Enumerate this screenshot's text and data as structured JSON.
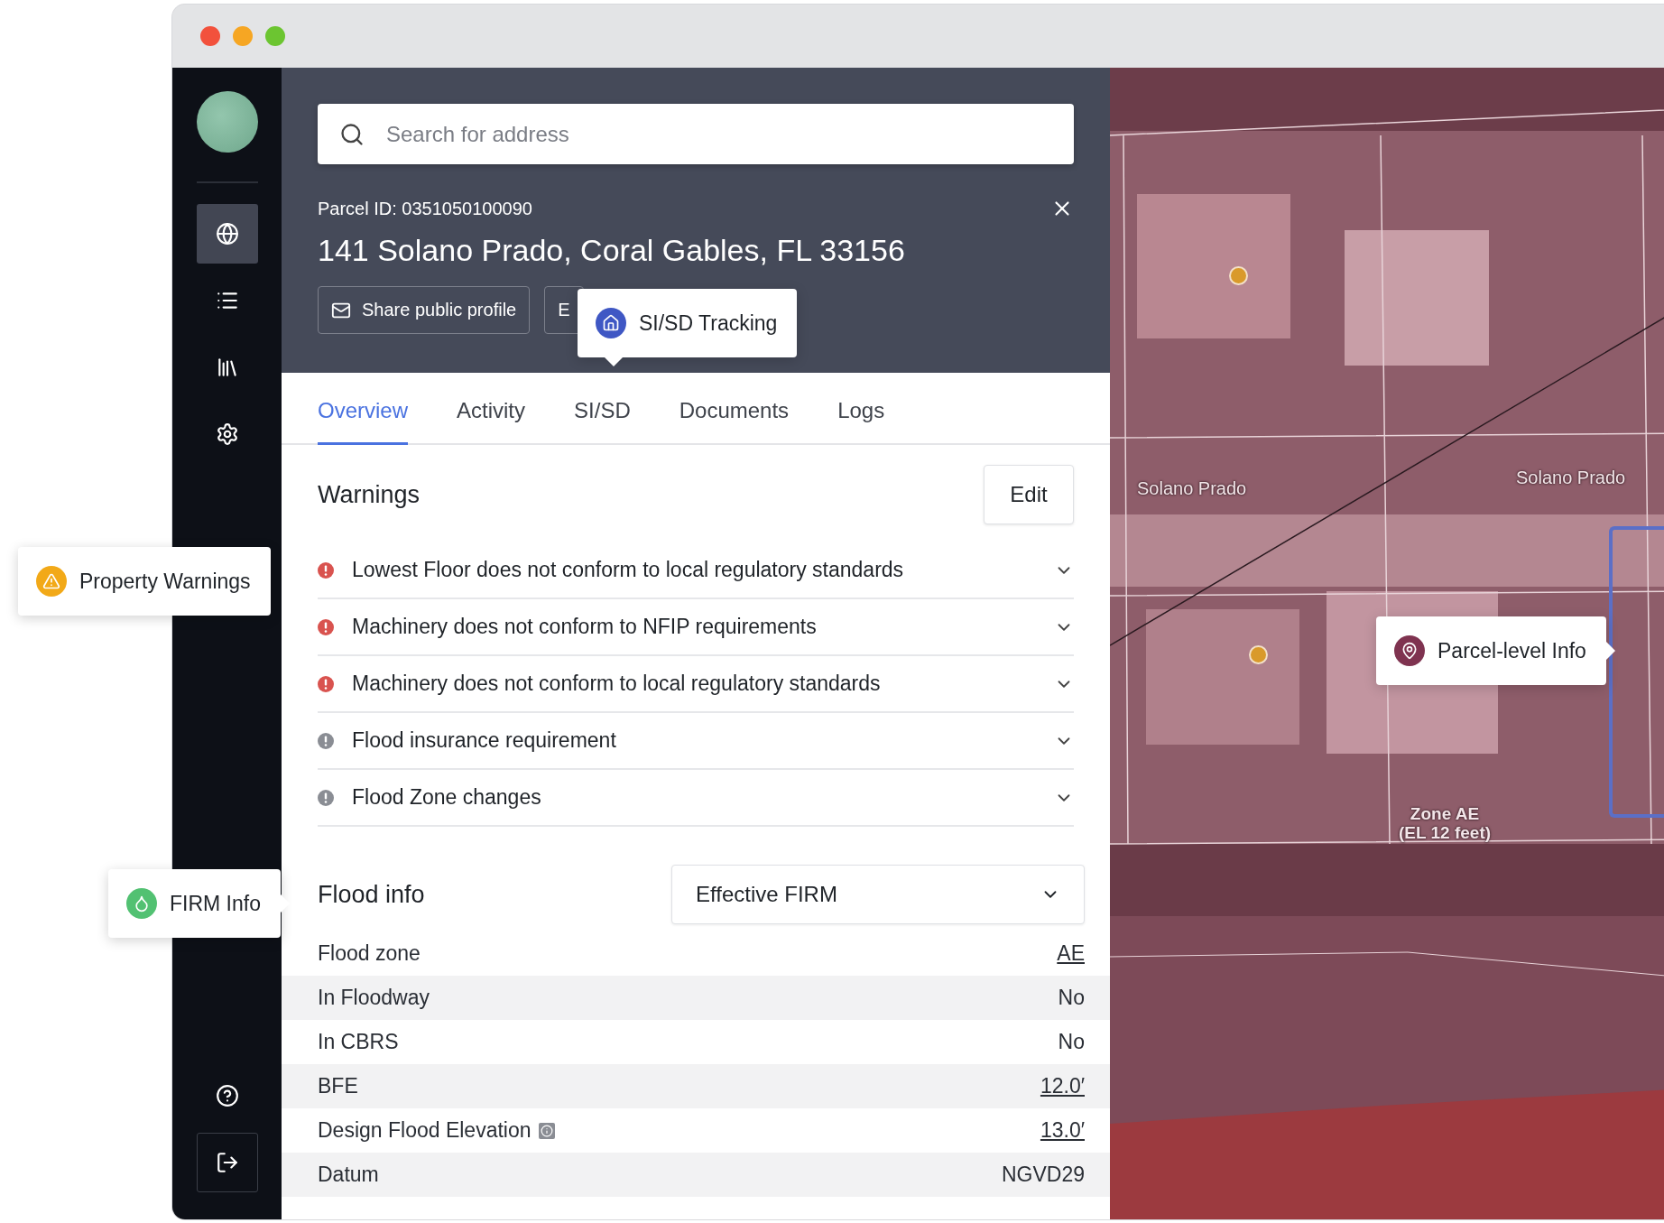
{
  "sidebar": {
    "items": [
      {
        "kind": "globe",
        "selected": true
      },
      {
        "kind": "list",
        "selected": false
      },
      {
        "kind": "books",
        "selected": false
      },
      {
        "kind": "settings",
        "selected": false
      }
    ],
    "footer": [
      {
        "kind": "help",
        "selected": false
      },
      {
        "kind": "logout",
        "selected": false
      }
    ]
  },
  "search": {
    "placeholder": "Search for address"
  },
  "parcel": {
    "id_label": "Parcel ID: 0351050100090",
    "address": "141 Solano Prado, Coral Gables, FL 33156",
    "buttons": [
      {
        "label": "Share public profile",
        "kind": "share"
      },
      {
        "label": "E",
        "kind": "plain"
      }
    ]
  },
  "tabs": [
    {
      "label": "Overview",
      "selected": true
    },
    {
      "label": "Activity",
      "selected": false
    },
    {
      "label": "SI/SD",
      "selected": false
    },
    {
      "label": "Documents",
      "selected": false
    },
    {
      "label": "Logs",
      "selected": false
    }
  ],
  "warnings": {
    "title": "Warnings",
    "edit_label": "Edit",
    "items": [
      {
        "text": "Lowest Floor does not conform to local regulatory standards",
        "color": "#d9534f",
        "expanded": false
      },
      {
        "text": "Machinery does not conform to NFIP requirements",
        "color": "#d9534f",
        "expanded": false
      },
      {
        "text": "Machinery does not conform to local regulatory standards",
        "color": "#d9534f",
        "expanded": false
      },
      {
        "text": "Flood insurance requirement",
        "color": "#8a8d94",
        "expanded": false
      },
      {
        "text": "Flood Zone changes",
        "color": "#8a8d94",
        "expanded": false
      }
    ]
  },
  "flood_info": {
    "title": "Flood info",
    "source": "Effective FIRM",
    "rows": [
      {
        "label": "Flood zone",
        "value": "AE",
        "link": true,
        "info": false
      },
      {
        "label": "In Floodway",
        "value": "No",
        "link": false,
        "info": false
      },
      {
        "label": "In CBRS",
        "value": "No",
        "link": false,
        "info": false
      },
      {
        "label": "BFE",
        "value": "12.0′",
        "link": true,
        "info": false
      },
      {
        "label": "Design Flood Elevation",
        "value": "13.0′",
        "link": true,
        "info": true
      },
      {
        "label": "Datum",
        "value": "NGVD29",
        "link": false,
        "info": false
      }
    ]
  },
  "map": {
    "labels": [
      {
        "kind": "street",
        "lines": [
          "Solano Prado"
        ]
      },
      {
        "kind": "street",
        "lines": [
          "Solano Prado"
        ]
      },
      {
        "kind": "zone",
        "lines": [
          "Zone AE",
          "(EL 12 feet)"
        ]
      }
    ]
  },
  "callouts": [
    {
      "kind": "home",
      "text": "SI/SD Tracking"
    },
    {
      "kind": "warning",
      "text": "Property Warnings"
    },
    {
      "kind": "drop",
      "text": "FIRM Info"
    },
    {
      "kind": "pin",
      "text": "Parcel-level Info"
    }
  ]
}
